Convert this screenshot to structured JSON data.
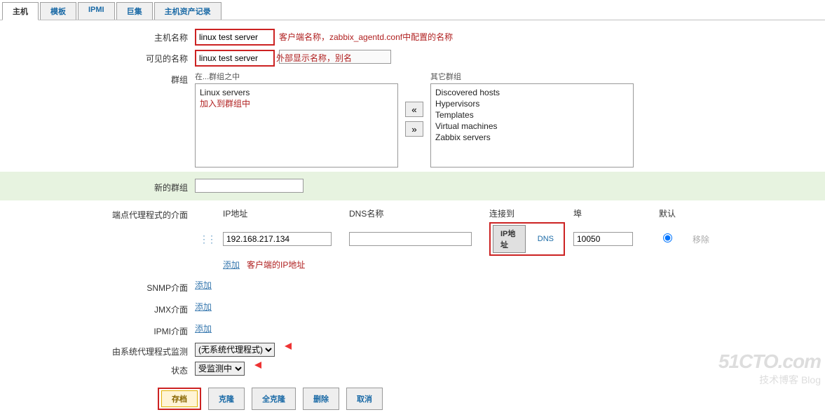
{
  "tabs": [
    {
      "label": "主机",
      "active": true
    },
    {
      "label": "模板",
      "active": false
    },
    {
      "label": "IPMI",
      "active": false
    },
    {
      "label": "巨集",
      "active": false
    },
    {
      "label": "主机资产记录",
      "active": false
    }
  ],
  "labels": {
    "hostname": "主机名称",
    "visiblename": "可见的名称",
    "groups": "群组",
    "in_groups": "在...群组之中",
    "other_groups": "其它群组",
    "new_group": "新的群组",
    "agent_iface": "端点代理程式的介面",
    "snmp_iface": "SNMP介面",
    "jmx_iface": "JMX介面",
    "ipmi_iface": "IPMI介面",
    "monitored_by": "由系统代理程式监测",
    "status": "状态"
  },
  "values": {
    "hostname": "linux test server",
    "visiblename": "linux test server",
    "new_group": "",
    "in_groups": [
      "Linux servers"
    ],
    "other_groups": [
      "Discovered hosts",
      "Hypervisors",
      "Templates",
      "Virtual machines",
      "Zabbix servers"
    ],
    "ip": "192.168.217.134",
    "dns": "",
    "port": "10050",
    "connect_to": "ip"
  },
  "iface_head": {
    "ip": "IP地址",
    "dns": "DNS名称",
    "connect": "连接到",
    "port": "埠",
    "default": "默认"
  },
  "conn": {
    "ip_label": "IP地址",
    "dns_label": "DNS"
  },
  "links": {
    "add": "添加",
    "remove": "移除"
  },
  "monitored_by": {
    "options": [
      "(无系统代理程式)"
    ],
    "selected": "(无系统代理程式)"
  },
  "status": {
    "options": [
      "受监测中"
    ],
    "selected": "受监测中"
  },
  "buttons": {
    "save": "存档",
    "clone": "克隆",
    "full_clone": "全克隆",
    "delete": "删除",
    "cancel": "取消"
  },
  "annotations": {
    "hostname": "客户端名称，zabbix_agentd.conf中配置的名称",
    "visiblename": "外部显示名称，别名",
    "in_groups": "加入到群组中",
    "ip": "客户端的IP地址"
  },
  "watermark": {
    "big": "51CTO.com",
    "small": "技术博客   Blog"
  }
}
